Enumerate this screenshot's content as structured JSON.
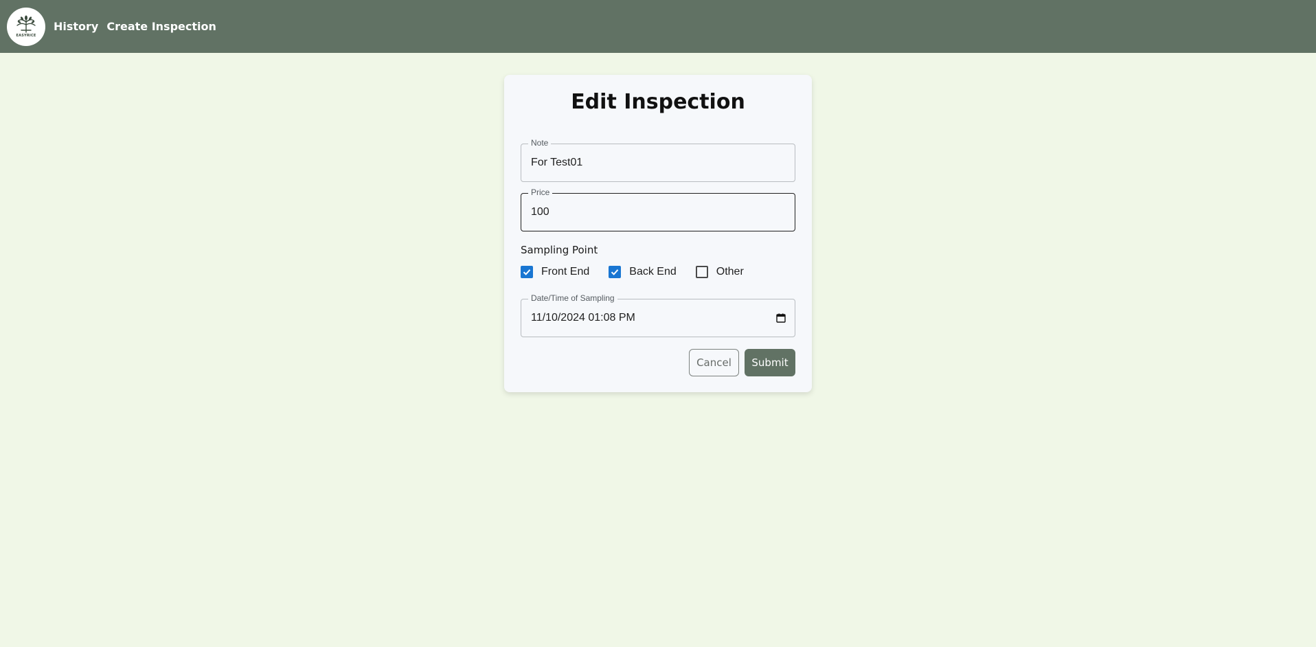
{
  "colors": {
    "header_bg": "#617264",
    "page_bg": "#f0f7e7",
    "card_bg": "#f6f8fb",
    "accent": "#1976d2",
    "submit_bg": "#617264"
  },
  "header": {
    "logo_text": "EASYRICE",
    "logo_icon": "rice-plant-icon",
    "nav": [
      {
        "label": "History"
      },
      {
        "label": "Create Inspection"
      }
    ]
  },
  "form": {
    "title": "Edit Inspection",
    "note": {
      "label": "Note",
      "value": "For Test01"
    },
    "price": {
      "label": "Price",
      "value": "100"
    },
    "sampling_point": {
      "label": "Sampling Point",
      "options": [
        {
          "label": "Front End",
          "checked": true
        },
        {
          "label": "Back End",
          "checked": true
        },
        {
          "label": "Other",
          "checked": false
        }
      ]
    },
    "datetime": {
      "label": "Date/Time of Sampling",
      "value": "11/10/2024 01:08 PM",
      "icon": "calendar-icon"
    },
    "cancel_label": "Cancel",
    "submit_label": "Submit"
  }
}
